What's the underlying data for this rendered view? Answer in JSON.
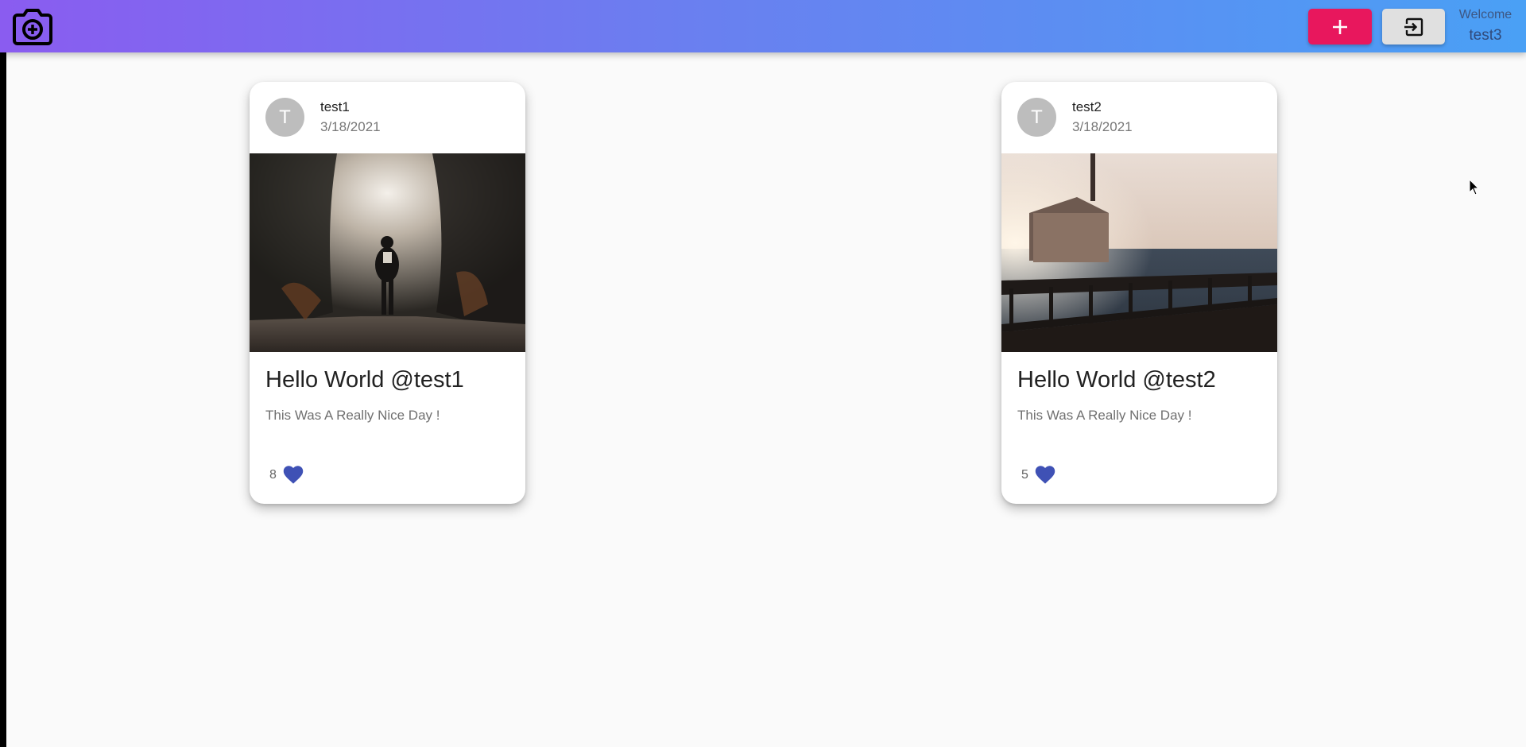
{
  "header": {
    "logo_icon": "camera-plus-icon",
    "add_icon": "plus-icon",
    "logout_icon": "logout-icon",
    "welcome_label": "Welcome",
    "username": "test3",
    "colors": {
      "gradient_start": "#8a5cf0",
      "gradient_end": "#4aa0f5",
      "add_button": "#e8175d",
      "logout_button": "#e0e0e0"
    }
  },
  "posts": [
    {
      "avatar_letter": "T",
      "author": "test1",
      "date": "3/18/2021",
      "title": "Hello World @test1",
      "body": "This Was A Really Nice Day !",
      "likes": "8",
      "like_icon": "heart-icon"
    },
    {
      "avatar_letter": "T",
      "author": "test2",
      "date": "3/18/2021",
      "title": "Hello World @test2",
      "body": "This Was A Really Nice Day !",
      "likes": "5",
      "like_icon": "heart-icon"
    }
  ],
  "colors": {
    "heart": "#3f51b5"
  }
}
